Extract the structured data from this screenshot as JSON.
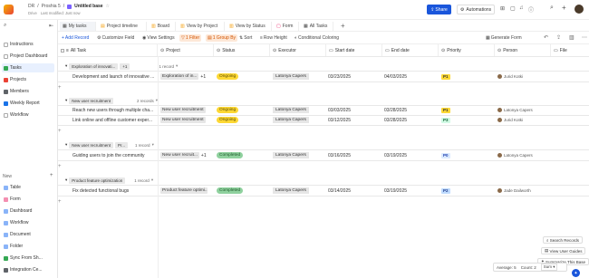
{
  "topbar": {
    "breadcrumb_root": "DR",
    "breadcrumb_space": "Proshia 5",
    "title": "Untitled base",
    "owner": "Drive",
    "last_modified": "Last modified: Just now",
    "share_label": "Share",
    "automations_label": "Automations"
  },
  "sidebar": {
    "items": [
      {
        "label": "Instructions",
        "color": "#9aa0a6"
      },
      {
        "label": "Project Dashboard",
        "color": "#9aa0a6"
      },
      {
        "label": "Tasks",
        "color": "#34a853"
      },
      {
        "label": "Projects",
        "color": "#ea4335"
      },
      {
        "label": "Members",
        "color": "#5f6368"
      },
      {
        "label": "Weekly Report",
        "color": "#1a73e8"
      },
      {
        "label": "Workflow",
        "color": "#9aa0a6"
      }
    ],
    "new_label": "New",
    "new_items": [
      {
        "label": "Table",
        "color": "#1a73e8"
      },
      {
        "label": "Form",
        "color": "#e91e63"
      },
      {
        "label": "Dashboard",
        "color": "#1a73e8"
      },
      {
        "label": "Workflow",
        "color": "#1a73e8"
      },
      {
        "label": "Document",
        "color": "#1a73e8"
      },
      {
        "label": "Folder",
        "color": "#1a73e8"
      },
      {
        "label": "Sync From Sh...",
        "color": "#34a853"
      },
      {
        "label": "Integration Ce...",
        "color": "#5f6368"
      }
    ]
  },
  "tabs": [
    "My tasks",
    "Project timeline",
    "Board",
    "View by Project",
    "View by Status",
    "Form",
    "All Tasks"
  ],
  "toolbar": {
    "add_record": "Add Record",
    "customize_field": "Customize Field",
    "view_settings": "View Settings",
    "filter": "1 Filter",
    "group_by": "1 Group By",
    "sort": "Sort",
    "row_height": "Row Height",
    "conditional": "Conditional Coloring",
    "generate_form": "Generate Form"
  },
  "columns": [
    "All Task",
    "Project",
    "Status",
    "Executor",
    "Start date",
    "End date",
    "Priority",
    "Person",
    "File"
  ],
  "groups": [
    {
      "tag": "Exploration of innovati...",
      "extra": "+1",
      "count": "1 record",
      "rows": [
        {
          "task": "Development and launch of innovative ...",
          "project": "Exploration of in...",
          "project_extra": "+1",
          "status": "Ongoing",
          "executor": "Latonya Capers",
          "start": "03/23/2025",
          "end": "04/03/2025",
          "priority": "P1",
          "person": "Jurid Kotki"
        }
      ]
    },
    {
      "tag": "New user recruitment",
      "extra": "",
      "count": "2 records",
      "rows": [
        {
          "task": "Reach new users through multiple cha...",
          "project": "New user recruitment",
          "project_extra": "",
          "status": "Ongoing",
          "executor": "Latonya Capers",
          "start": "03/03/2025",
          "end": "03/28/2025",
          "priority": "P1",
          "person": "Latonya Capers"
        },
        {
          "task": "Link online and offline customer exper...",
          "project": "New user recruitment",
          "project_extra": "",
          "status": "Ongoing",
          "executor": "Latonya Capers",
          "start": "03/12/2025",
          "end": "03/28/2025",
          "priority": "P3",
          "person": "Jurid Kotki"
        }
      ]
    },
    {
      "tag": "New user recruitment",
      "extra": "Pr...",
      "count": "1 record",
      "rows": [
        {
          "task": "Guiding users to join the community",
          "project": "New user recruit...",
          "project_extra": "+1",
          "status": "Completed",
          "executor": "Latonya Capers",
          "start": "03/16/2025",
          "end": "03/19/2025",
          "priority": "P0",
          "person": "Latonya Capers"
        }
      ]
    },
    {
      "tag": "Product feature optimization",
      "extra": "",
      "count": "1 record",
      "rows": [
        {
          "task": "Fix detected functional bugs",
          "project": "Product feature optimi...",
          "project_extra": "",
          "status": "Completed",
          "executor": "Latonya Capers",
          "start": "03/14/2025",
          "end": "03/19/2025",
          "priority": "P2",
          "person": "Jade Dailworth"
        }
      ]
    }
  ],
  "add_record_row": "+",
  "bottom": {
    "search_records": "Search Records",
    "view_user_guides": "View User Guides",
    "summarize": "Summarize This Base",
    "average": "Average: 5",
    "count": "Count: 2",
    "sum": "Sum"
  }
}
